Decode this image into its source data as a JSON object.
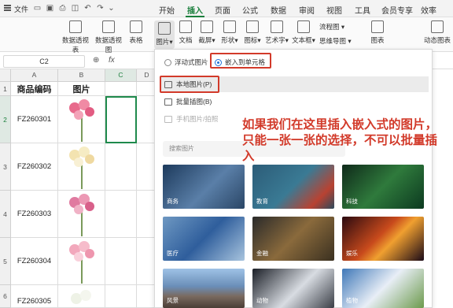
{
  "menubar": {
    "file": "文件",
    "tabs": [
      "开始",
      "插入",
      "页面",
      "公式",
      "数据",
      "审阅",
      "视图",
      "工具",
      "会员专享",
      "效率"
    ]
  },
  "ribbon": {
    "buttons": [
      "数据透视表",
      "数据透视图",
      "表格",
      "图片",
      "文档",
      "截屏",
      "形状",
      "图标",
      "艺术字",
      "文本框",
      "流程图",
      "思维导图",
      "图表",
      "动态图表"
    ]
  },
  "formula_bar": {
    "name_box": "C2",
    "fx": "fx"
  },
  "sheet": {
    "columns": [
      "A",
      "B",
      "C",
      "D"
    ],
    "rows": [
      "1",
      "2",
      "3",
      "4",
      "5",
      "6"
    ],
    "header": {
      "code": "商品编码",
      "image": "图片"
    },
    "codes": [
      "FZ260301",
      "FZ260302",
      "FZ260303",
      "FZ260304",
      "FZ260305"
    ]
  },
  "panel": {
    "float_option": "浮动式图片",
    "embed_option": "嵌入到单元格",
    "local_image": "本地图片(P)",
    "batch_insert": "批量插图(B)",
    "phone_image": "手机图片/拍照",
    "search_placeholder": "搜索图片",
    "categories": [
      "商务",
      "教育",
      "科技",
      "医疗",
      "金融",
      "娱乐",
      "风景",
      "动物",
      "植物"
    ]
  },
  "annotation": "如果我们在这里插入嵌入式的图片，只能一张一张的选择，不可以批量插入",
  "colors": {
    "accent": "#1a7f3c",
    "annotation": "#d23a2a"
  }
}
